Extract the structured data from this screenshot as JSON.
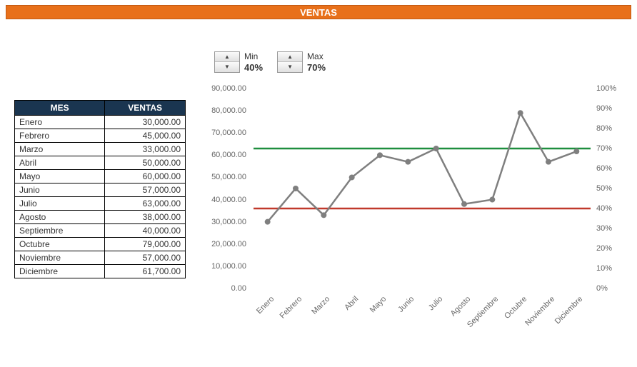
{
  "banner": {
    "title": "VENTAS"
  },
  "spinners": {
    "min": {
      "label": "Min",
      "value": "40%"
    },
    "max": {
      "label": "Max",
      "value": "70%"
    }
  },
  "table": {
    "headers": {
      "month": "MES",
      "sales": "VENTAS"
    },
    "rows": [
      {
        "month": "Enero",
        "sales": "30,000.00"
      },
      {
        "month": "Febrero",
        "sales": "45,000.00"
      },
      {
        "month": "Marzo",
        "sales": "33,000.00"
      },
      {
        "month": "Abril",
        "sales": "50,000.00"
      },
      {
        "month": "Mayo",
        "sales": "60,000.00"
      },
      {
        "month": "Junio",
        "sales": "57,000.00"
      },
      {
        "month": "Julio",
        "sales": "63,000.00"
      },
      {
        "month": "Agosto",
        "sales": "38,000.00"
      },
      {
        "month": "Septiembre",
        "sales": "40,000.00"
      },
      {
        "month": "Octubre",
        "sales": "79,000.00"
      },
      {
        "month": "Noviembre",
        "sales": "57,000.00"
      },
      {
        "month": "Diciembre",
        "sales": "61,700.00"
      }
    ]
  },
  "chart_data": {
    "type": "line",
    "categories": [
      "Enero",
      "Febrero",
      "Marzo",
      "Abril",
      "Mayo",
      "Junio",
      "Julio",
      "Agosto",
      "Septiembre",
      "Octubre",
      "Noviembre",
      "Diciembre"
    ],
    "series": [
      {
        "name": "Ventas",
        "values": [
          30000,
          45000,
          33000,
          50000,
          60000,
          57000,
          63000,
          38000,
          40000,
          79000,
          57000,
          61700
        ],
        "axis": "left"
      },
      {
        "name": "Min",
        "constant": 0.4,
        "axis": "right",
        "color": "#C0392B"
      },
      {
        "name": "Max",
        "constant": 0.7,
        "axis": "right",
        "color": "#1E8E3E"
      }
    ],
    "y_left": {
      "min": 0,
      "max": 90000,
      "ticks": [
        "0.00",
        "10,000.00",
        "20,000.00",
        "30,000.00",
        "40,000.00",
        "50,000.00",
        "60,000.00",
        "70,000.00",
        "80,000.00",
        "90,000.00"
      ]
    },
    "y_right": {
      "min": 0,
      "max": 1.0,
      "ticks": [
        "0%",
        "10%",
        "20%",
        "30%",
        "40%",
        "50%",
        "60%",
        "70%",
        "80%",
        "90%",
        "100%"
      ]
    }
  }
}
